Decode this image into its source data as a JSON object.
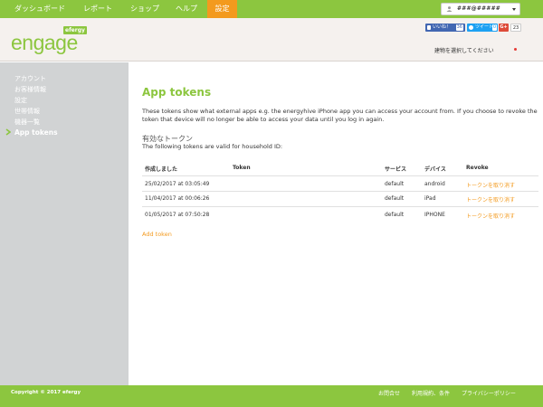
{
  "nav": {
    "items": [
      "ダッシュボード",
      "レポート",
      "ショップ",
      "ヘルプ",
      "設定"
    ],
    "active": "設定"
  },
  "user": {
    "name": "###@#####"
  },
  "header": {
    "logo_text": "engage",
    "logo_badge": "efergy",
    "fb_label": "いいね！",
    "fb_count": "36",
    "tw_label": "ツイート",
    "tw_count": "0",
    "gplus_label": "G+",
    "gplus_count": "23",
    "building_select": "建物を選択してください"
  },
  "sidebar": {
    "items": [
      {
        "label": "アカウント"
      },
      {
        "label": "お客様情報"
      },
      {
        "label": "設定"
      },
      {
        "label": "世帯情報"
      },
      {
        "label": "機器一覧"
      },
      {
        "label": "App tokens",
        "active": true
      }
    ]
  },
  "main": {
    "title": "App tokens",
    "description": "These tokens show what external apps e.g. the energyhive iPhone app you can access your account from. If you choose to revoke the token that device will no longer be able to access your data until you log in again.",
    "subheading": "有効なトークン",
    "subtext": "The following tokens are valid for household ID:",
    "table": {
      "columns": [
        "作成しました",
        "Token",
        "サービス",
        "デバイス",
        "Revoke"
      ],
      "rows": [
        [
          "25/02/2017 at 03:05:49",
          "",
          "default",
          "android",
          "トークンを取り消す"
        ],
        [
          "11/04/2017 at 00:06:26",
          "",
          "default",
          "iPad",
          "トークンを取り消す"
        ],
        [
          "01/05/2017 at 07:50:28",
          "",
          "default",
          "IPHONE",
          "トークンを取り消す"
        ]
      ]
    },
    "add_token": "Add token"
  },
  "footer": {
    "copyright": "Copyright © 2017 efergy",
    "links": [
      "お問合せ",
      "利用規約、条件",
      "プライバシーポリシー"
    ]
  },
  "colors": {
    "brand_green": "#8cc63f",
    "accent_orange": "#f39a1e",
    "sidebar_gray": "#d1d3d4"
  }
}
